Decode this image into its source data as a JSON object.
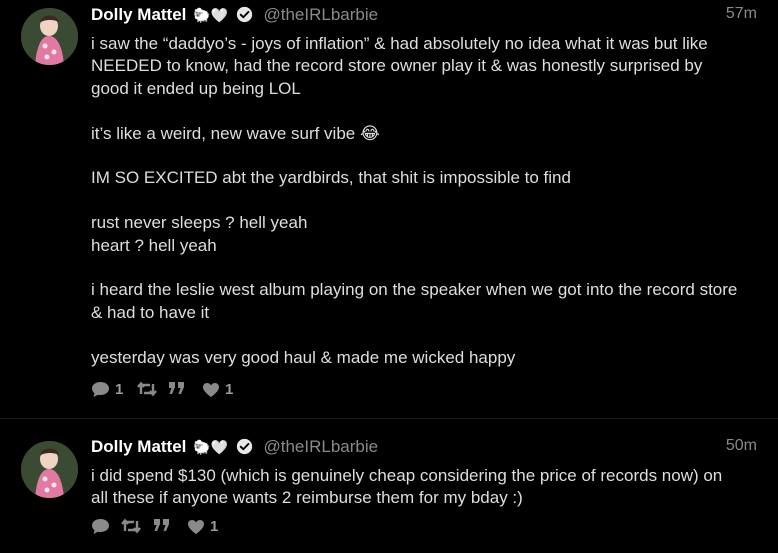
{
  "tweets": [
    {
      "user": {
        "name": "Dolly Mattel",
        "emoji": "🐑🤍",
        "handle": "@theIRLbarbie"
      },
      "time": "57m",
      "text": "i saw the “daddyo’s - joys of inflation” & had absolutely no idea what it was but like\nNEEDED to know, had the record store owner play it & was honestly surprised by\ngood it ended up being LOL\n\nit’s like a weird, new wave surf vibe 😂\n\nIM SO EXCITED abt the yardbirds, that shit is impossible to find\n\nrust never sleeps ? hell yeah\nheart ? hell yeah\n\ni heard the leslie west album playing on the speaker when we got into the record store\n& had to have it\n\nyesterday was very good haul & made me wicked happy",
      "actions": {
        "reply_count": "1",
        "retweet_count": "",
        "quote_count": "",
        "like_count": "1"
      }
    },
    {
      "user": {
        "name": "Dolly Mattel",
        "emoji": "🐑🤍",
        "handle": "@theIRLbarbie"
      },
      "time": "50m",
      "text": "i did spend $130 (which is genuinely cheap considering the price of records now) on\nall these if anyone wants 2 reimburse them for my bday :)",
      "actions": {
        "reply_count": "",
        "retweet_count": "",
        "quote_count": "",
        "like_count": "1"
      }
    }
  ],
  "colors": {
    "background": "#000000",
    "text": "#dedede",
    "muted": "#8a8a8a",
    "name": "#ffffff"
  },
  "icons": {
    "reply": "speech-bubble-icon",
    "retweet": "retweet-icon",
    "quote": "quote-icon",
    "like": "heart-icon",
    "verified": "verified-badge-icon"
  }
}
